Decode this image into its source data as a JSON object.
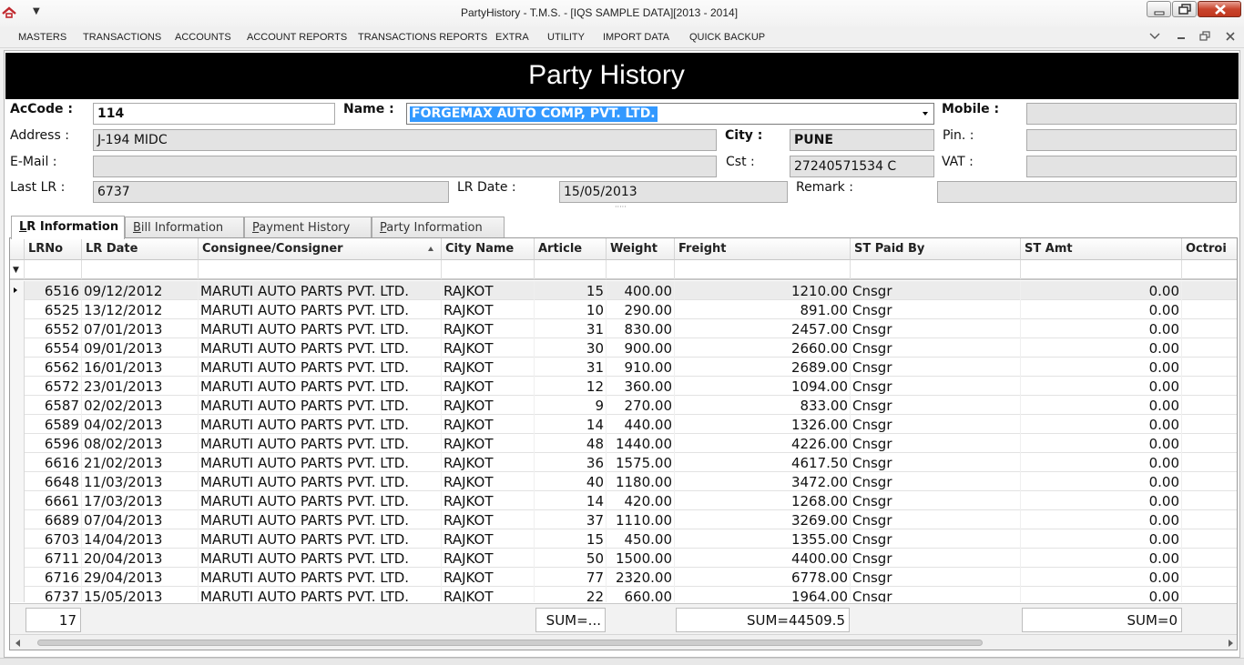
{
  "window": {
    "title": "PartyHistory - T.M.S. - [IQS SAMPLE DATA][2013 - 2014]"
  },
  "menu": [
    "MASTERS",
    "TRANSACTIONS",
    "ACCOUNTS",
    "ACCOUNT REPORTS",
    "TRANSACTIONS REPORTS",
    "EXTRA",
    "UTILITY",
    "IMPORT DATA",
    "QUICK BACKUP"
  ],
  "header": {
    "title": "Party History"
  },
  "form": {
    "accode_label": "AcCode :",
    "accode_value": "114",
    "name_label": "Name :",
    "name_value": "FORGEMAX AUTO COMP, PVT. LTD.",
    "mobile_label": "Mobile :",
    "mobile_value": "",
    "address_label": "Address :",
    "address_value": "J-194 MIDC",
    "city_label": "City :",
    "city_value": "PUNE",
    "pin_label": "Pin. :",
    "pin_value": "",
    "email_label": "E-Mail :",
    "email_value": "",
    "cst_label": "Cst :",
    "cst_value": "27240571534 C",
    "vat_label": "VAT :",
    "vat_value": "",
    "lastlr_label": "Last LR :",
    "lastlr_value": "6737",
    "lrdate_label": "LR Date :",
    "lrdate_value": "15/05/2013",
    "remark_label": "Remark :",
    "remark_value": ""
  },
  "tabs": [
    {
      "key": "L",
      "rest": "R Information"
    },
    {
      "key": "B",
      "rest": "ill Information"
    },
    {
      "key": "P",
      "rest": "ayment History"
    },
    {
      "key": "P",
      "rest": "arty Information"
    }
  ],
  "grid": {
    "columns": [
      "LRNo",
      "LR Date",
      "Consignee/Consigner",
      "City Name",
      "Article",
      "Weight",
      "Freight",
      "ST Paid By",
      "ST Amt",
      "Octroi"
    ],
    "rows": [
      [
        "6516",
        "09/12/2012",
        "MARUTI AUTO PARTS PVT. LTD.",
        "RAJKOT",
        "15",
        "400.00",
        "1210.00",
        "Cnsgr",
        "0.00"
      ],
      [
        "6525",
        "13/12/2012",
        "MARUTI AUTO PARTS PVT. LTD.",
        "RAJKOT",
        "10",
        "290.00",
        "891.00",
        "Cnsgr",
        "0.00"
      ],
      [
        "6552",
        "07/01/2013",
        "MARUTI AUTO PARTS PVT. LTD.",
        "RAJKOT",
        "31",
        "830.00",
        "2457.00",
        "Cnsgr",
        "0.00"
      ],
      [
        "6554",
        "09/01/2013",
        "MARUTI AUTO PARTS PVT. LTD.",
        "RAJKOT",
        "30",
        "900.00",
        "2660.00",
        "Cnsgr",
        "0.00"
      ],
      [
        "6562",
        "16/01/2013",
        "MARUTI AUTO PARTS PVT. LTD.",
        "RAJKOT",
        "31",
        "910.00",
        "2689.00",
        "Cnsgr",
        "0.00"
      ],
      [
        "6572",
        "23/01/2013",
        "MARUTI AUTO PARTS PVT. LTD.",
        "RAJKOT",
        "12",
        "360.00",
        "1094.00",
        "Cnsgr",
        "0.00"
      ],
      [
        "6587",
        "02/02/2013",
        "MARUTI AUTO PARTS PVT. LTD.",
        "RAJKOT",
        "9",
        "270.00",
        "833.00",
        "Cnsgr",
        "0.00"
      ],
      [
        "6589",
        "04/02/2013",
        "MARUTI AUTO PARTS PVT. LTD.",
        "RAJKOT",
        "14",
        "440.00",
        "1326.00",
        "Cnsgr",
        "0.00"
      ],
      [
        "6596",
        "08/02/2013",
        "MARUTI AUTO PARTS PVT. LTD.",
        "RAJKOT",
        "48",
        "1440.00",
        "4226.00",
        "Cnsgr",
        "0.00"
      ],
      [
        "6616",
        "21/02/2013",
        "MARUTI AUTO PARTS PVT. LTD.",
        "RAJKOT",
        "36",
        "1575.00",
        "4617.50",
        "Cnsgr",
        "0.00"
      ],
      [
        "6648",
        "11/03/2013",
        "MARUTI AUTO PARTS PVT. LTD.",
        "RAJKOT",
        "40",
        "1180.00",
        "3472.00",
        "Cnsgr",
        "0.00"
      ],
      [
        "6661",
        "17/03/2013",
        "MARUTI AUTO PARTS PVT. LTD.",
        "RAJKOT",
        "14",
        "420.00",
        "1268.00",
        "Cnsgr",
        "0.00"
      ],
      [
        "6689",
        "07/04/2013",
        "MARUTI AUTO PARTS PVT. LTD.",
        "RAJKOT",
        "37",
        "1110.00",
        "3269.00",
        "Cnsgr",
        "0.00"
      ],
      [
        "6703",
        "14/04/2013",
        "MARUTI AUTO PARTS PVT. LTD.",
        "RAJKOT",
        "15",
        "450.00",
        "1355.00",
        "Cnsgr",
        "0.00"
      ],
      [
        "6711",
        "20/04/2013",
        "MARUTI AUTO PARTS PVT. LTD.",
        "RAJKOT",
        "50",
        "1500.00",
        "4400.00",
        "Cnsgr",
        "0.00"
      ],
      [
        "6716",
        "29/04/2013",
        "MARUTI AUTO PARTS PVT. LTD.",
        "RAJKOT",
        "77",
        "2320.00",
        "6778.00",
        "Cnsgr",
        "0.00"
      ],
      [
        "6737",
        "15/05/2013",
        "MARUTI AUTO PARTS PVT. LTD.",
        "RAJKOT",
        "22",
        "660.00",
        "1964.00",
        "Cnsgr",
        "0.00"
      ]
    ],
    "footer": {
      "count": "17",
      "weight_sum": "SUM=...",
      "freight_sum": "SUM=44509.5",
      "stamt_sum": "SUM=0"
    }
  }
}
